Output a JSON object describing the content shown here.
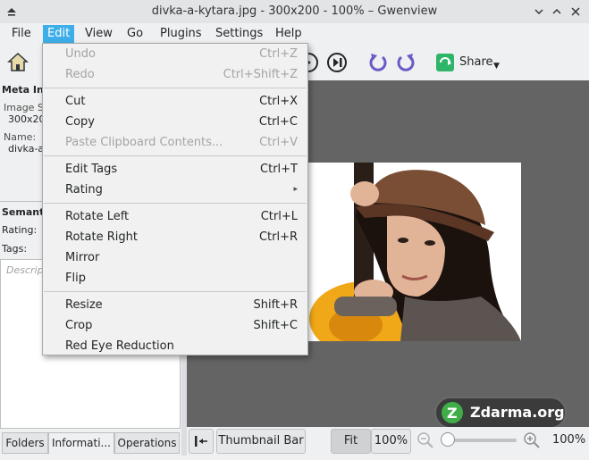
{
  "window": {
    "title": "divka-a-kytara.jpg - 300x200 - 100% – Gwenview"
  },
  "menubar": [
    "File",
    "Edit",
    "View",
    "Go",
    "Plugins",
    "Settings",
    "Help"
  ],
  "toolbar": {
    "share_label": "Share"
  },
  "edit_menu": {
    "items": [
      {
        "label": "Undo",
        "shortcut": "Ctrl+Z",
        "enabled": false
      },
      {
        "label": "Redo",
        "shortcut": "Ctrl+Shift+Z",
        "enabled": false
      },
      {
        "label": "Cut",
        "shortcut": "Ctrl+X",
        "enabled": true
      },
      {
        "label": "Copy",
        "shortcut": "Ctrl+C",
        "enabled": true
      },
      {
        "label": "Paste Clipboard Contents...",
        "shortcut": "Ctrl+V",
        "enabled": false
      },
      {
        "label": "Edit Tags",
        "shortcut": "Ctrl+T",
        "enabled": true
      },
      {
        "label": "Rating",
        "shortcut": "▸",
        "enabled": true
      },
      {
        "label": "Rotate Left",
        "shortcut": "Ctrl+L",
        "enabled": true
      },
      {
        "label": "Rotate Right",
        "shortcut": "Ctrl+R",
        "enabled": true
      },
      {
        "label": "Mirror",
        "shortcut": "",
        "enabled": true
      },
      {
        "label": "Flip",
        "shortcut": "",
        "enabled": true
      },
      {
        "label": "Resize",
        "shortcut": "Shift+R",
        "enabled": true
      },
      {
        "label": "Crop",
        "shortcut": "Shift+C",
        "enabled": true
      },
      {
        "label": "Red Eye Reduction",
        "shortcut": "",
        "enabled": true
      }
    ]
  },
  "sidebar": {
    "meta_heading": "Meta Inf",
    "image_size_label": "Image S",
    "image_size_value": "300x20",
    "name_label": "Name:",
    "name_value": "divka-a",
    "semantic_heading": "Semant",
    "rating_label": "Rating:",
    "tags_label": "Tags:",
    "description_placeholder": "Descrip",
    "tabs": [
      "Folders",
      "Informati...",
      "Operations"
    ]
  },
  "statusbar": {
    "thumbnail_bar_label": "Thumbnail Bar",
    "fit_label": "Fit",
    "zoom_value_left": "100%",
    "zoom_value_right": "100%",
    "zoom_level": 0.0
  },
  "watermark": {
    "text": "Zdarma.org"
  },
  "colors": {
    "highlight": "#3daee9",
    "viewer_bg": "#646464",
    "menu_bg": "#f1f1f1"
  }
}
